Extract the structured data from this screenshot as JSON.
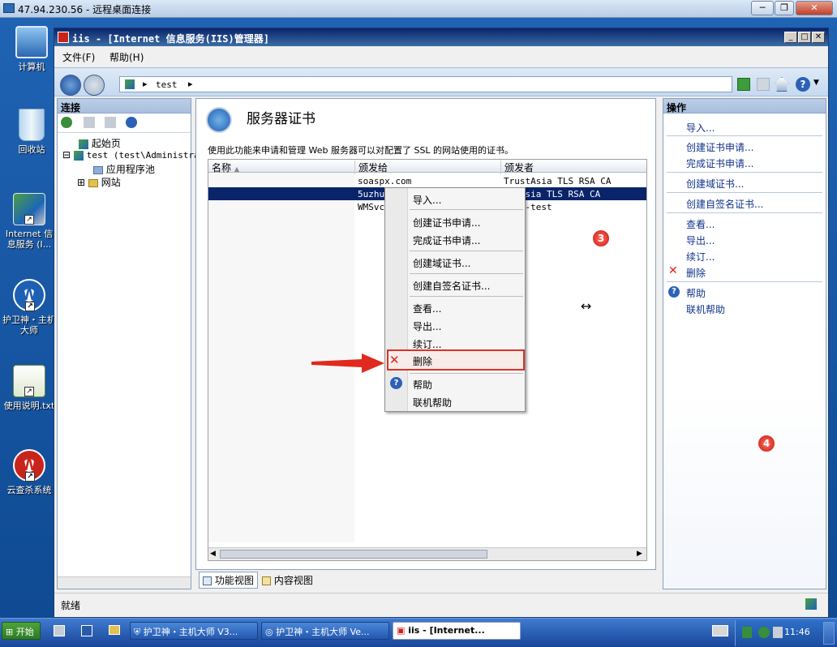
{
  "rdp": {
    "title": "47.94.230.56 - 远程桌面连接",
    "min": "─",
    "restore": "❐",
    "close": "✕"
  },
  "desktop": {
    "icons": [
      {
        "label": "计算机"
      },
      {
        "label": "回收站"
      },
      {
        "label": "Internet 信息服务 (I..."
      },
      {
        "label": "护卫神・主机大师"
      },
      {
        "label": "使用说明.txt"
      },
      {
        "label": "云查杀系统"
      }
    ]
  },
  "window": {
    "title": "iis - [Internet 信息服务(IIS)管理器]",
    "menu": [
      "文件(F)",
      "帮助(H)"
    ],
    "address": "test",
    "address_arrow": "▸"
  },
  "left_pane": {
    "header": "连接",
    "tree": [
      {
        "label": "起始页"
      },
      {
        "label": "test (test\\Administrator)"
      },
      {
        "label": "应用程序池"
      },
      {
        "label": "网站"
      }
    ]
  },
  "center": {
    "title": "服务器证书",
    "description": "使用此功能来申请和管理 Web 服务器可以对配置了 SSL 的网站使用的证书。",
    "columns": [
      "名称",
      "颁发给",
      "颁发者"
    ],
    "rows": [
      {
        "name": "",
        "issued_to": "soaspx.com",
        "issuer": "TrustAsia TLS RSA CA"
      },
      {
        "name": "",
        "issued_to": "5uzhu...",
        "issuer": "...Asia TLS RSA CA"
      },
      {
        "name": "",
        "issued_to": "WMSvc-...",
        "issuer": "...c-test"
      }
    ],
    "tabs": [
      "功能视图",
      "内容视图"
    ]
  },
  "right_pane": {
    "header": "操作",
    "actions": [
      "导入...",
      "创建证书申请...",
      "完成证书申请...",
      "创建域证书...",
      "创建自签名证书...",
      "查看...",
      "导出...",
      "续订...",
      "删除",
      "帮助",
      "联机帮助"
    ]
  },
  "context_menu": {
    "items": [
      "导入...",
      "创建证书申请...",
      "完成证书申请...",
      "创建域证书...",
      "创建自签名证书...",
      "查看...",
      "导出...",
      "续订...",
      "删除",
      "帮助",
      "联机帮助"
    ]
  },
  "annotations": {
    "badge3": "3",
    "badge4": "4"
  },
  "status": {
    "text": "就绪"
  },
  "taskbar": {
    "start": "开始",
    "buttons": [
      "护卫神・主机大师 V3...",
      "护卫神・主机大师 Ve...",
      "iis - [Internet..."
    ],
    "clock": "11:46"
  },
  "colors": {
    "title_bar": "#0a246a",
    "selection": "#0a246a",
    "highlight_box": "#d9342b",
    "link": "#10338a"
  }
}
